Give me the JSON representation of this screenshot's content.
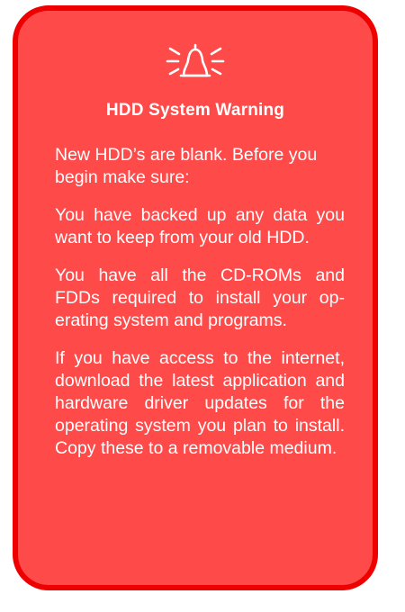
{
  "warning": {
    "icon": "alarm-bell-icon",
    "title": "HDD System Warning",
    "paragraphs": [
      "New HDD’s are blank. Before you begin make sure:",
      "You have backed up any data you want to keep from your old HDD.",
      "You have all the CD-ROMs and FDDs required to install your op­erating system and programs.",
      "If you have access to the internet, download the latest application and hardware driver updates for the operating system you plan to install. Copy these to a remov­able medium."
    ],
    "colors": {
      "background": "#ff4a4a",
      "border": "#ee0000",
      "text": "#ffffff"
    }
  }
}
